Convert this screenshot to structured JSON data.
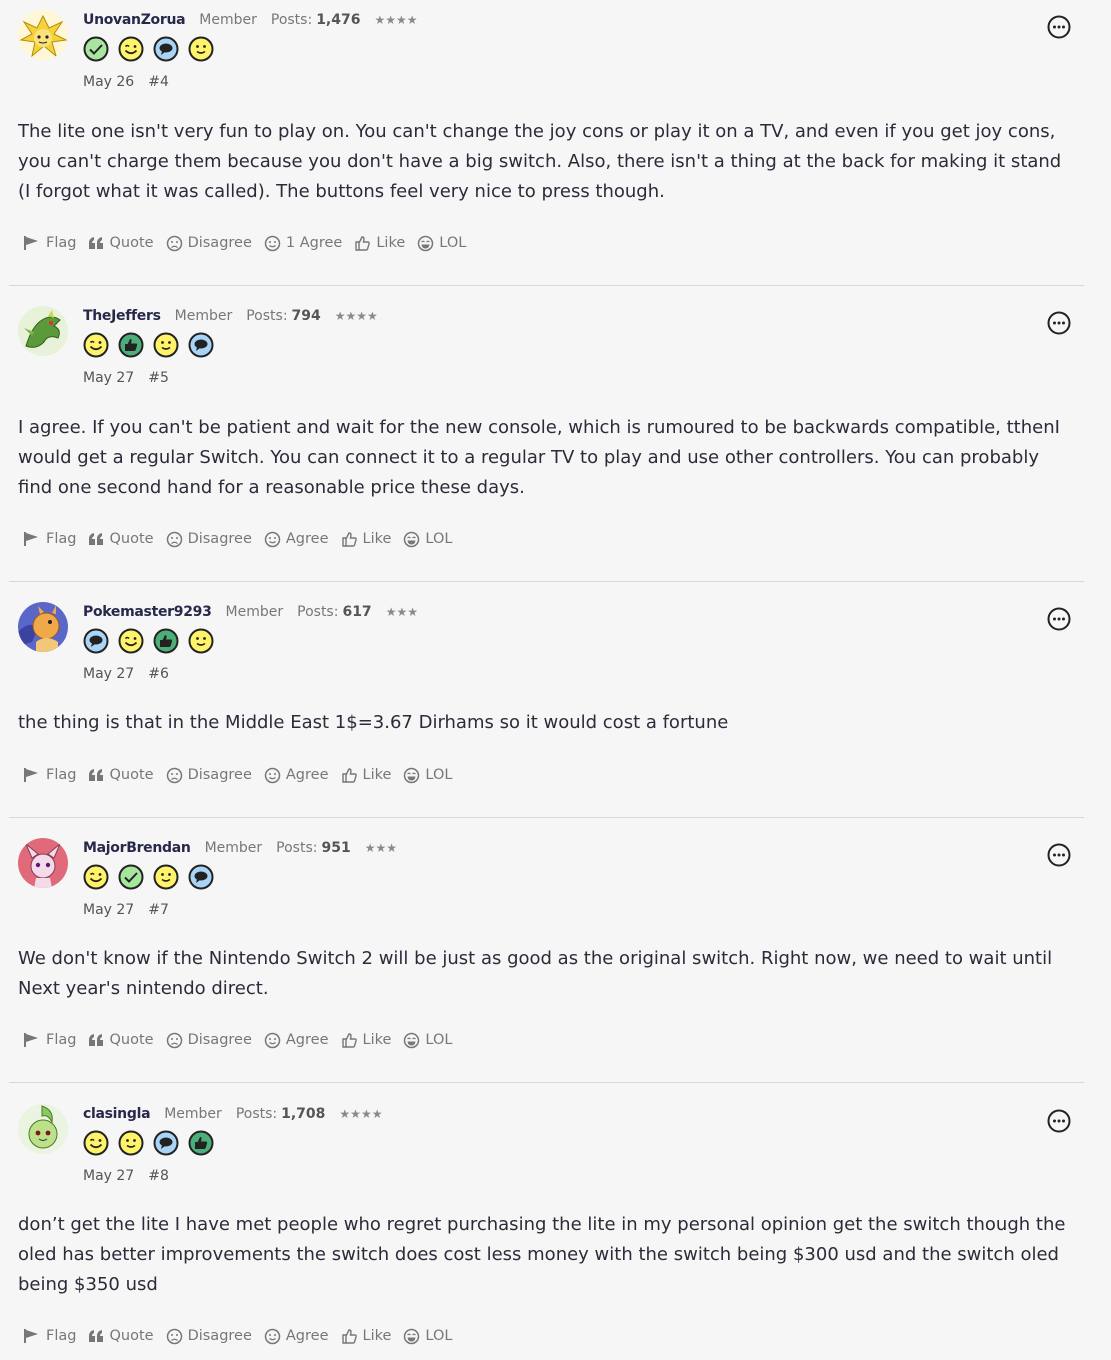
{
  "actions_labels": {
    "flag": "Flag",
    "quote": "Quote",
    "disagree": "Disagree",
    "agree": "Agree",
    "like": "Like",
    "lol": "LOL"
  },
  "posts": [
    {
      "username": "UnovanZorua",
      "role": "Member",
      "posts_label": "Posts:",
      "posts_count": "1,476",
      "stars": "★★★★",
      "badges": [
        "check-badge-icon",
        "grin-badge-icon",
        "speech-bubble-badge-icon",
        "smile-badge-icon"
      ],
      "date": "May 26",
      "post_number": "#4",
      "text": "The lite one isn't very fun to play on. You can't change the joy cons or play it on a TV, and even if you get joy cons, you can't charge them because you don't have a big switch. Also, there isn't a thing at the back for making it stand (I forgot what it was called). The buttons feel very nice to press though.",
      "agree_label": "1 Agree",
      "avatar_color": "#f3d23a"
    },
    {
      "username": "TheJeffers",
      "role": "Member",
      "posts_label": "Posts:",
      "posts_count": "794",
      "stars": "★★★★",
      "badges": [
        "grin-badge-icon",
        "thumbs-up-badge-icon",
        "smile-badge-icon",
        "speech-bubble-badge-icon"
      ],
      "date": "May 27",
      "post_number": "#5",
      "text": "I agree. If you can't be patient and wait for the new console, which is rumoured to be backwards compatible, tthenI would get a regular Switch. You can connect it to a regular TV to play and use other controllers. You can probably find one second hand for a reasonable price these days.",
      "agree_label": "Agree",
      "avatar_color": "#5a9a3a"
    },
    {
      "username": "Pokemaster9293",
      "role": "Member",
      "posts_label": "Posts:",
      "posts_count": "617",
      "stars": "★★★",
      "badges": [
        "speech-bubble-badge-icon",
        "grin-badge-icon",
        "thumbs-up-badge-icon",
        "smile-badge-icon"
      ],
      "date": "May 27",
      "post_number": "#6",
      "text": "the thing is that in the Middle East 1$=3.67 Dirhams so it would cost a fortune",
      "agree_label": "Agree",
      "avatar_color": "#e8a64a"
    },
    {
      "username": "MajorBrendan",
      "role": "Member",
      "posts_label": "Posts:",
      "posts_count": "951",
      "stars": "★★★",
      "badges": [
        "grin-badge-icon",
        "check-badge-icon",
        "smile-badge-icon",
        "speech-bubble-badge-icon"
      ],
      "date": "May 27",
      "post_number": "#7",
      "text": "We don't know if the Nintendo Switch 2 will be just as good as the original switch. Right now, we need to wait until Next year's nintendo direct.",
      "agree_label": "Agree",
      "avatar_color": "#e07080"
    },
    {
      "username": "clasingla",
      "role": "Member",
      "posts_label": "Posts:",
      "posts_count": "1,708",
      "stars": "★★★★",
      "badges": [
        "grin-badge-icon",
        "smile-badge-icon",
        "speech-bubble-badge-icon",
        "thumbs-up-badge-icon"
      ],
      "date": "May 27",
      "post_number": "#8",
      "text": "don’t get the lite I have met people who regret purchasing the lite in my personal opinion get the switch though the oled has better improvements the switch does cost less money with the switch being $300 usd and the switch oled being $350 usd",
      "agree_label": "Agree",
      "avatar_color": "#8cc860"
    }
  ]
}
